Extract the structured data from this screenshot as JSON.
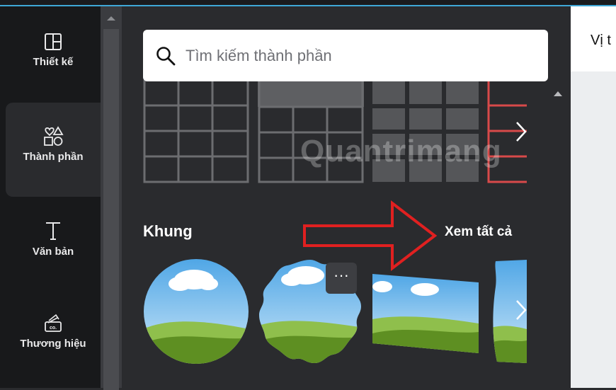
{
  "sidebar": {
    "items": [
      {
        "label": "Thiết kế",
        "icon": "layout-icon"
      },
      {
        "label": "Thành phần",
        "icon": "shapes-icon"
      },
      {
        "label": "Văn bản",
        "icon": "text-icon"
      },
      {
        "label": "Thương hiệu",
        "icon": "brand-kit-icon"
      }
    ],
    "active": "Thành phần"
  },
  "search": {
    "placeholder": "Tìm kiếm thành phần",
    "value": ""
  },
  "sections": {
    "frames": {
      "title": "Khung",
      "see_all": "Xem tất cả"
    }
  },
  "watermark": "Quantrimang",
  "right_panel": {
    "title": "Vị t"
  },
  "colors": {
    "sidebar_bg": "#18191b",
    "panel_bg": "#2a2b2e",
    "accent_blue": "#3fa8d8",
    "annotation_red": "#e02020"
  }
}
